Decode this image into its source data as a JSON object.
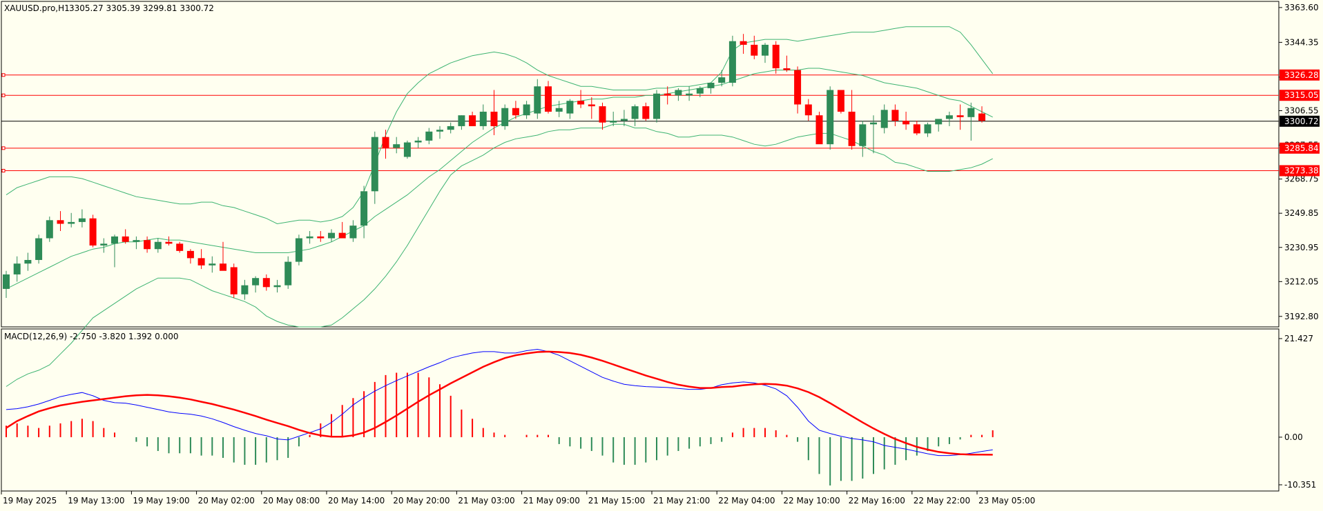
{
  "header": {
    "symbol": "XAUUSD.pro,H1",
    "ohlc": "3305.27 3305.39 3299.81 3300.72"
  },
  "macd_header": "MACD(12,26,9) -2.750 -3.820 1.392 0.000",
  "colors": {
    "background": "#FFFFF0",
    "bull": "#2E8B57",
    "bear": "#FF0000",
    "bollinger": "#3CB371",
    "macd_line": "#0000FF",
    "signal_line": "#FF0000",
    "level_line": "#FF0000",
    "price_line": "#000000"
  },
  "chart_data": [
    {
      "type": "candlestick",
      "title": "XAUUSD.pro,H1",
      "ylim": [
        3187,
        3367
      ],
      "price_axis_ticks": [
        "3363.60",
        "3344.35",
        "3325.10",
        "3306.55",
        "3287.55",
        "3268.75",
        "3249.85",
        "3230.95",
        "3212.05",
        "3192.80"
      ],
      "current_price": "3300.72",
      "horizontal_levels": [
        "3326.28",
        "3315.05",
        "3285.84",
        "3273.38"
      ],
      "time_axis_labels": [
        "19 May 2025",
        "19 May 13:00",
        "19 May 19:00",
        "20 May 02:00",
        "20 May 08:00",
        "20 May 14:00",
        "20 May 20:00",
        "21 May 03:00",
        "21 May 09:00",
        "21 May 15:00",
        "21 May 21:00",
        "22 May 04:00",
        "22 May 10:00",
        "22 May 16:00",
        "22 May 22:00",
        "23 May 05:00"
      ],
      "ohlc": [
        [
          3208,
          3218,
          3203,
          3216
        ],
        [
          3216,
          3226,
          3212,
          3222
        ],
        [
          3222,
          3228,
          3218,
          3224
        ],
        [
          3224,
          3238,
          3222,
          3236
        ],
        [
          3236,
          3248,
          3234,
          3246
        ],
        [
          3246,
          3251,
          3240,
          3244
        ],
        [
          3244,
          3250,
          3242,
          3245
        ],
        [
          3245,
          3252,
          3242,
          3247
        ],
        [
          3247,
          3249,
          3231,
          3232
        ],
        [
          3232,
          3236,
          3228,
          3233
        ],
        [
          3233,
          3238,
          3220,
          3237
        ],
        [
          3237,
          3241,
          3233,
          3234
        ],
        [
          3234,
          3237,
          3230,
          3235
        ],
        [
          3235,
          3237,
          3228,
          3230
        ],
        [
          3230,
          3236,
          3228,
          3234
        ],
        [
          3234,
          3237,
          3232,
          3233
        ],
        [
          3233,
          3234,
          3228,
          3229
        ],
        [
          3229,
          3230,
          3222,
          3225
        ],
        [
          3225,
          3230,
          3219,
          3221
        ],
        [
          3221,
          3226,
          3217,
          3222
        ],
        [
          3222,
          3234,
          3220,
          3218
        ],
        [
          3220,
          3222,
          3203,
          3205
        ],
        [
          3205,
          3213,
          3202,
          3210
        ],
        [
          3210,
          3215,
          3206,
          3214
        ],
        [
          3214,
          3216,
          3207,
          3209
        ],
        [
          3209,
          3213,
          3206,
          3210
        ],
        [
          3210,
          3226,
          3208,
          3223
        ],
        [
          3223,
          3238,
          3221,
          3236
        ],
        [
          3236,
          3240,
          3233,
          3237
        ],
        [
          3237,
          3240,
          3234,
          3236
        ],
        [
          3236,
          3241,
          3234,
          3239
        ],
        [
          3239,
          3245,
          3236,
          3236
        ],
        [
          3236,
          3246,
          3234,
          3243
        ],
        [
          3243,
          3265,
          3236,
          3262
        ],
        [
          3262,
          3295,
          3255,
          3292
        ],
        [
          3292,
          3296,
          3280,
          3286
        ],
        [
          3286,
          3292,
          3283,
          3288
        ],
        [
          3281,
          3290,
          3280,
          3289
        ],
        [
          3289,
          3292,
          3286,
          3290
        ],
        [
          3290,
          3297,
          3288,
          3295
        ],
        [
          3295,
          3298,
          3291,
          3296
        ],
        [
          3296,
          3300,
          3294,
          3298
        ],
        [
          3298,
          3304,
          3296,
          3304
        ],
        [
          3304,
          3306,
          3298,
          3298
        ],
        [
          3298,
          3310,
          3296,
          3306
        ],
        [
          3306,
          3318,
          3293,
          3298
        ],
        [
          3298,
          3310,
          3296,
          3308
        ],
        [
          3308,
          3312,
          3302,
          3304
        ],
        [
          3304,
          3312,
          3302,
          3310
        ],
        [
          3305,
          3324,
          3302,
          3320
        ],
        [
          3320,
          3323,
          3305,
          3306
        ],
        [
          3306,
          3312,
          3303,
          3308
        ],
        [
          3305,
          3313,
          3302,
          3312
        ],
        [
          3312,
          3318,
          3308,
          3310
        ],
        [
          3310,
          3314,
          3302,
          3309
        ],
        [
          3309,
          3311,
          3296,
          3300
        ],
        [
          3300,
          3306,
          3298,
          3301
        ],
        [
          3301,
          3307,
          3298,
          3302
        ],
        [
          3302,
          3310,
          3298,
          3309
        ],
        [
          3309,
          3311,
          3301,
          3302
        ],
        [
          3302,
          3318,
          3300,
          3316
        ],
        [
          3316,
          3320,
          3310,
          3315
        ],
        [
          3315,
          3319,
          3312,
          3318
        ],
        [
          3315,
          3320,
          3312,
          3316
        ],
        [
          3316,
          3320,
          3314,
          3319
        ],
        [
          3319,
          3322,
          3316,
          3322
        ],
        [
          3322,
          3329,
          3320,
          3325
        ],
        [
          3322,
          3348,
          3320,
          3345
        ],
        [
          3345,
          3349,
          3338,
          3343
        ],
        [
          3343,
          3348,
          3335,
          3337
        ],
        [
          3337,
          3344,
          3333,
          3343
        ],
        [
          3343,
          3345,
          3327,
          3330
        ],
        [
          3330,
          3337,
          3328,
          3329
        ],
        [
          3329,
          3331,
          3305,
          3310
        ],
        [
          3310,
          3313,
          3301,
          3304
        ],
        [
          3304,
          3306,
          3292,
          3288
        ],
        [
          3288,
          3320,
          3285,
          3318
        ],
        [
          3318,
          3318,
          3305,
          3306
        ],
        [
          3306,
          3318,
          3285,
          3287
        ],
        [
          3287,
          3301,
          3281,
          3299
        ],
        [
          3299,
          3304,
          3283,
          3300
        ],
        [
          3297,
          3310,
          3294,
          3307
        ],
        [
          3307,
          3310,
          3298,
          3301
        ],
        [
          3301,
          3306,
          3296,
          3299
        ],
        [
          3299,
          3301,
          3293,
          3294
        ],
        [
          3294,
          3300,
          3292,
          3299
        ],
        [
          3299,
          3301,
          3295,
          3302
        ],
        [
          3302,
          3306,
          3298,
          3304
        ],
        [
          3304,
          3310,
          3296,
          3303
        ],
        [
          3303,
          3311,
          3290,
          3308
        ],
        [
          3305,
          3309,
          3300,
          3301
        ]
      ],
      "bollinger": {
        "upper": [
          3260,
          3264,
          3266,
          3268,
          3270,
          3270,
          3270,
          3269,
          3267,
          3265,
          3263,
          3261,
          3259,
          3258,
          3257,
          3256,
          3255,
          3255,
          3256,
          3256,
          3254,
          3253,
          3251,
          3249,
          3247,
          3244,
          3245,
          3246,
          3246,
          3245,
          3246,
          3248,
          3253,
          3262,
          3277,
          3293,
          3306,
          3316,
          3322,
          3327,
          3330,
          3333,
          3335,
          3337,
          3338,
          3339,
          3338,
          3336,
          3333,
          3329,
          3326,
          3324,
          3322,
          3320,
          3320,
          3319,
          3318,
          3318,
          3318,
          3318,
          3319,
          3319,
          3320,
          3320,
          3321,
          3322,
          3328,
          3340,
          3344,
          3345,
          3346,
          3346,
          3346,
          3345,
          3346,
          3347,
          3348,
          3349,
          3350,
          3350,
          3350,
          3351,
          3352,
          3353,
          3353,
          3353,
          3353,
          3353,
          3350,
          3343,
          3335,
          3327
        ],
        "middle": [
          3208,
          3211,
          3214,
          3217,
          3220,
          3223,
          3226,
          3228,
          3230,
          3231,
          3233,
          3234,
          3234,
          3235,
          3236,
          3235,
          3235,
          3234,
          3233,
          3232,
          3231,
          3230,
          3229,
          3228,
          3228,
          3228,
          3228,
          3229,
          3230,
          3232,
          3234,
          3237,
          3240,
          3243,
          3248,
          3252,
          3256,
          3260,
          3265,
          3270,
          3274,
          3279,
          3284,
          3289,
          3293,
          3297,
          3300,
          3303,
          3305,
          3307,
          3309,
          3310,
          3311,
          3312,
          3313,
          3313,
          3314,
          3314,
          3314,
          3315,
          3315,
          3316,
          3317,
          3318,
          3319,
          3320,
          3321,
          3323,
          3325,
          3327,
          3328,
          3329,
          3329,
          3329,
          3330,
          3330,
          3329,
          3328,
          3327,
          3326,
          3324,
          3322,
          3321,
          3320,
          3319,
          3317,
          3315,
          3313,
          3312,
          3309,
          3306,
          3303
        ],
        "lower": [
          3154,
          3158,
          3161,
          3163,
          3166,
          3172,
          3178,
          3185,
          3192,
          3196,
          3200,
          3204,
          3208,
          3211,
          3214,
          3214,
          3214,
          3213,
          3210,
          3207,
          3205,
          3203,
          3201,
          3198,
          3193,
          3190,
          3188,
          3187,
          3187,
          3187,
          3188,
          3192,
          3197,
          3202,
          3208,
          3215,
          3223,
          3232,
          3242,
          3252,
          3262,
          3271,
          3276,
          3279,
          3282,
          3286,
          3289,
          3291,
          3292,
          3293,
          3295,
          3296,
          3296,
          3297,
          3297,
          3297,
          3299,
          3299,
          3297,
          3297,
          3295,
          3294,
          3292,
          3292,
          3293,
          3293,
          3293,
          3292,
          3290,
          3288,
          3287,
          3288,
          3290,
          3292,
          3293,
          3294,
          3294,
          3292,
          3290,
          3287,
          3284,
          3282,
          3278,
          3277,
          3275,
          3273,
          3273,
          3273,
          3274,
          3275,
          3277,
          3280
        ]
      }
    },
    {
      "type": "macd",
      "title": "MACD(12,26,9)",
      "ylim": [
        -10.351,
        21.427
      ],
      "axis_ticks": [
        "21.427",
        "0.00",
        "-10.351"
      ],
      "histogram": [
        2.5,
        3.0,
        2.5,
        2.0,
        2.5,
        3.0,
        3.5,
        4.0,
        3.5,
        2.0,
        1.0,
        0.0,
        -1.0,
        -2.0,
        -3.0,
        -3.5,
        -3.5,
        -3.5,
        -4.0,
        -4.0,
        -4.5,
        -5.5,
        -6.0,
        -6.0,
        -5.5,
        -5.0,
        -4.5,
        -2.0,
        0.5,
        3.0,
        5.0,
        7.0,
        8.5,
        10.0,
        12.0,
        13.5,
        14.0,
        14.0,
        14.0,
        13.0,
        11.5,
        9.0,
        6.0,
        4.0,
        2.0,
        1.0,
        0.5,
        0.0,
        0.5,
        0.5,
        0.5,
        -1.5,
        -2.0,
        -2.5,
        -3.0,
        -4.0,
        -5.5,
        -6.0,
        -6.0,
        -5.5,
        -5.0,
        -4.0,
        -3.0,
        -2.5,
        -2.0,
        -1.5,
        -1.0,
        1.0,
        2.0,
        2.0,
        2.0,
        1.5,
        0.5,
        -1.0,
        -5.0,
        -8.0,
        -10.5,
        -9.5,
        -9.5,
        -9.0,
        -8.0,
        -7.0,
        -6.0,
        -5.0,
        -4.0,
        -3.0,
        -2.0,
        -1.5,
        -0.5,
        0.5,
        0.5,
        1.5
      ],
      "macd": [
        6.0,
        6.2,
        6.6,
        7.2,
        8.0,
        8.8,
        9.3,
        9.7,
        9.0,
        8.0,
        7.5,
        7.4,
        7.0,
        6.5,
        6.0,
        5.5,
        5.2,
        5.0,
        4.6,
        4.0,
        3.2,
        2.3,
        1.5,
        0.8,
        0.3,
        -0.4,
        -0.6,
        0.2,
        1.0,
        1.8,
        3.2,
        5.0,
        7.0,
        8.6,
        10.0,
        11.2,
        12.3,
        13.3,
        14.3,
        15.3,
        16.2,
        17.2,
        17.8,
        18.3,
        18.6,
        18.6,
        18.3,
        18.3,
        18.8,
        19.1,
        18.6,
        17.8,
        16.6,
        15.4,
        14.2,
        13.0,
        12.2,
        11.5,
        11.2,
        11.0,
        10.9,
        10.8,
        10.6,
        10.4,
        10.4,
        10.7,
        11.4,
        11.8,
        12.0,
        11.8,
        11.3,
        10.5,
        9.0,
        6.5,
        3.5,
        1.5,
        0.8,
        0.2,
        -0.3,
        -0.6,
        -1.0,
        -1.8,
        -2.2,
        -2.6,
        -3.1,
        -3.6,
        -4.0,
        -4.0,
        -3.8,
        -3.5,
        -3.1,
        -2.75
      ],
      "signal": [
        2.0,
        3.5,
        4.6,
        5.6,
        6.3,
        6.9,
        7.3,
        7.7,
        8.0,
        8.3,
        8.6,
        8.9,
        9.1,
        9.2,
        9.1,
        8.9,
        8.6,
        8.2,
        7.7,
        7.2,
        6.6,
        6.0,
        5.3,
        4.6,
        3.8,
        3.1,
        2.4,
        1.6,
        0.9,
        0.4,
        0.1,
        0.1,
        0.4,
        1.0,
        2.0,
        3.3,
        4.7,
        6.2,
        7.7,
        9.1,
        10.4,
        11.7,
        12.9,
        14.1,
        15.3,
        16.3,
        17.2,
        17.8,
        18.2,
        18.5,
        18.6,
        18.5,
        18.3,
        17.9,
        17.3,
        16.6,
        15.8,
        15.0,
        14.2,
        13.4,
        12.7,
        12.0,
        11.4,
        11.0,
        10.7,
        10.7,
        10.9,
        11.0,
        11.3,
        11.5,
        11.6,
        11.5,
        11.2,
        10.6,
        9.8,
        8.7,
        7.4,
        6.0,
        4.6,
        3.2,
        1.9,
        0.7,
        -0.4,
        -1.3,
        -2.1,
        -2.7,
        -3.2,
        -3.5,
        -3.7,
        -3.8,
        -3.8,
        -3.82
      ]
    }
  ]
}
